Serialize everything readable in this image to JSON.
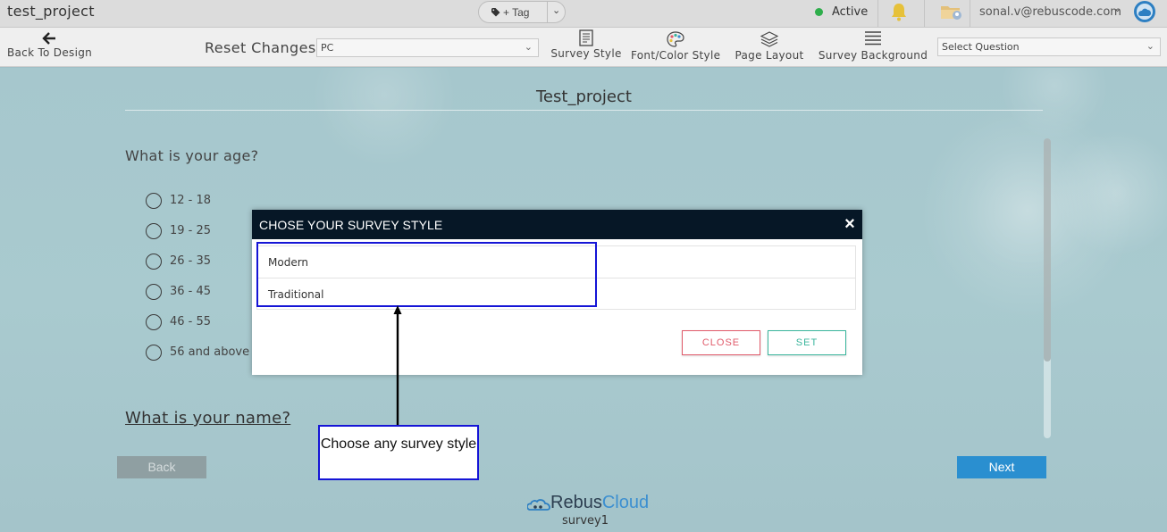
{
  "topbar": {
    "project_title": "test_project",
    "tag_label": "+ Tag",
    "status": "Active",
    "user_email": "sonal.v@rebuscode.com"
  },
  "toolbar": {
    "back_label": "Back To Design",
    "reset_label": "Reset Changes",
    "device_select": "PC",
    "survey_style": "Survey Style",
    "font_color_style": "Font/Color Style",
    "page_layout": "Page Layout",
    "survey_background": "Survey Background",
    "question_select": "Select Question"
  },
  "survey": {
    "title": "Test_project",
    "question1": "What is your age?",
    "options": [
      "12 - 18",
      "19 - 25",
      "26 - 35",
      "36 - 45",
      "46 - 55",
      "56 and above"
    ],
    "question2": "What is your name?",
    "back_label": "Back",
    "next_label": "Next",
    "brand_rebus": "Rebus",
    "brand_cloud": "Cloud",
    "survey_name": "survey1"
  },
  "modal": {
    "title": "CHOSE YOUR SURVEY STYLE",
    "styles": [
      "Modern",
      "Traditional"
    ],
    "close_label": "CLOSE",
    "set_label": "SET"
  },
  "annotation": {
    "callout_text": "Choose any survey style"
  },
  "colors": {
    "modal_header": "#061726",
    "annotation_blue": "#1515d6",
    "next_button": "#2a8fd0",
    "close_red": "#e05a6a",
    "set_green": "#39b59c",
    "status_green": "#2eae4b"
  },
  "icons": [
    "tag-icon",
    "bell-icon",
    "folder-icon",
    "cloud-avatar-icon",
    "back-arrow-icon",
    "survey-style-icon",
    "palette-icon",
    "layers-icon",
    "hamburger-icon",
    "close-icon",
    "rebus-cloud-logo-icon"
  ]
}
